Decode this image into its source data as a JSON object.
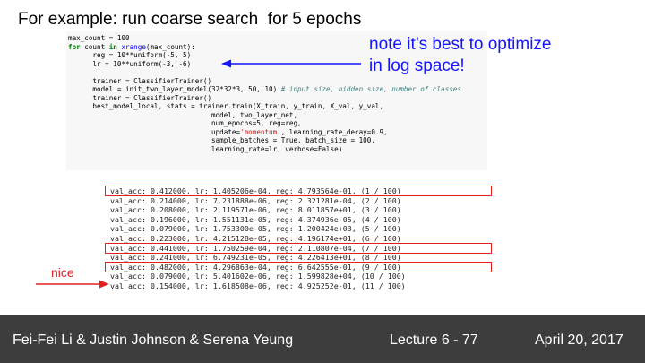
{
  "slide": {
    "title": "For example: run coarse search  for 5 epochs"
  },
  "code": {
    "lines": [
      "max_count = 100",
      "for count in xrange(max_count):",
      "      reg = 10**uniform(-5, 5)",
      "      lr = 10**uniform(-3, -6)",
      "",
      "      trainer = ClassifierTrainer()",
      "      model = init_two_layer_model(32*32*3, 50, 10) # input size, hidden size, number of classes",
      "      trainer = ClassifierTrainer()",
      "      best_model_local, stats = trainer.train(X_train, y_train, X_val, y_val,",
      "                                   model, two_layer_net,",
      "                                   num_epochs=5, reg=reg,",
      "                                   update='momentum', learning_rate_decay=0.9,",
      "                                   sample_batches = True, batch_size = 100,",
      "                                   learning_rate=lr, verbose=False)"
    ]
  },
  "note": {
    "line1": "note it’s best to optimize",
    "line2": "in log space!"
  },
  "output": {
    "lines": [
      "val_acc: 0.412000, lr: 1.405206e-04, reg: 4.793564e-01, (1 / 100)",
      "val_acc: 0.214000, lr: 7.231888e-06, reg: 2.321281e-04, (2 / 100)",
      "val_acc: 0.208000, lr: 2.119571e-06, reg: 8.011857e+01, (3 / 100)",
      "val_acc: 0.196000, lr: 1.551131e-05, reg: 4.374936e-05, (4 / 100)",
      "val_acc: 0.079000, lr: 1.753300e-05, reg: 1.200424e+03, (5 / 100)",
      "val_acc: 0.223000, lr: 4.215128e-05, reg: 4.196174e+01, (6 / 100)",
      "val_acc: 0.441000, lr: 1.750259e-04, reg: 2.110807e-04, (7 / 100)",
      "val_acc: 0.241000, lr: 6.749231e-05, reg: 4.226413e+01, (8 / 100)",
      "val_acc: 0.482000, lr: 4.296863e-04, reg: 6.642555e-01, (9 / 100)",
      "val_acc: 0.079000, lr: 5.401602e-06, reg: 1.599828e+04, (10 / 100)",
      "val_acc: 0.154000, lr: 1.618508e-06, reg: 4.925252e-01, (11 / 100)"
    ],
    "nice_label": "nice"
  },
  "footer": {
    "authors": "Fei-Fei Li & Justin Johnson & Serena Yeung",
    "lecture": "Lecture 6 - 77",
    "date": "April 20, 2017"
  },
  "colors": {
    "note_blue": "#1414ff",
    "highlight_red": "#e02020",
    "footer_bg": "#3d3d3d",
    "code_bg": "#f7f7f7"
  }
}
